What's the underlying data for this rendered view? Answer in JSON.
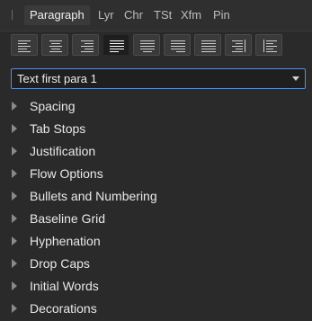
{
  "tabs": [
    {
      "label": "Paragraph",
      "active": true
    },
    {
      "label": "Lyr"
    },
    {
      "label": "Chr"
    },
    {
      "label": "TSt"
    },
    {
      "label": "Xfm"
    },
    {
      "label": "Pin"
    }
  ],
  "alignment_buttons": [
    {
      "icon": "align-left-icon"
    },
    {
      "icon": "align-center-icon"
    },
    {
      "icon": "align-right-icon"
    },
    {
      "icon": "justify-left-icon",
      "selected": true
    },
    {
      "icon": "justify-center-icon"
    },
    {
      "icon": "justify-right-icon"
    },
    {
      "icon": "justify-all-icon"
    },
    {
      "icon": "align-towards-spine-icon"
    },
    {
      "icon": "align-away-from-spine-icon"
    }
  ],
  "style_select": {
    "value": "Text first para 1"
  },
  "sections": [
    {
      "label": "Spacing"
    },
    {
      "label": "Tab Stops"
    },
    {
      "label": "Justification"
    },
    {
      "label": "Flow Options"
    },
    {
      "label": "Bullets and Numbering"
    },
    {
      "label": "Baseline Grid"
    },
    {
      "label": "Hyphenation"
    },
    {
      "label": "Drop Caps"
    },
    {
      "label": "Initial Words"
    },
    {
      "label": "Decorations"
    }
  ],
  "colors": {
    "panel_bg": "#2a2a2a",
    "select_border": "#5f8ccf",
    "text": "#e8e8e8"
  }
}
